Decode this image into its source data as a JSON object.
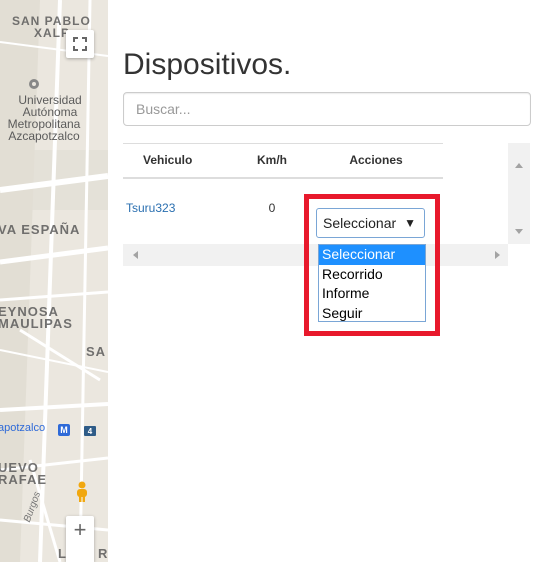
{
  "map": {
    "labels": {
      "san_pablo": "SAN PABLO",
      "xalpa": "XALP",
      "universidad": "Universidad",
      "autonoma": "Autónoma",
      "metropolitana": "Metropolitana",
      "azcapotzalco": "Azcapotzalco",
      "nva_espana": "VA ESPAÑA",
      "reynosa": "EYNOSA",
      "tamaulipas": "MAULIPAS",
      "sa": "SA",
      "metro_station": "apotzalco",
      "metro_badge": "M",
      "route_badge": "4",
      "nuevo": "UEVO",
      "rafael": "RAFAE",
      "burgos": "Burgos",
      "bottom_l": "L",
      "bottom_re": "RE"
    },
    "controls": {
      "zoom_in": "+"
    }
  },
  "panel": {
    "title": "Dispositivos.",
    "search": {
      "placeholder": "Buscar...",
      "value": ""
    },
    "table": {
      "headers": {
        "vehiculo": "Vehiculo",
        "kmh": "Km/h",
        "acciones": "Acciones"
      },
      "rows": [
        {
          "vehiculo": "Tsuru323",
          "kmh": "0",
          "accion": "Seleccionar"
        }
      ]
    },
    "dropdown": {
      "caret": "▼",
      "options": [
        "Seleccionar",
        "Recorrido",
        "Informe",
        "Seguir"
      ],
      "selected_index": 0,
      "highlight_color": "#e8192c",
      "selected_color": "#1e90ff"
    }
  }
}
